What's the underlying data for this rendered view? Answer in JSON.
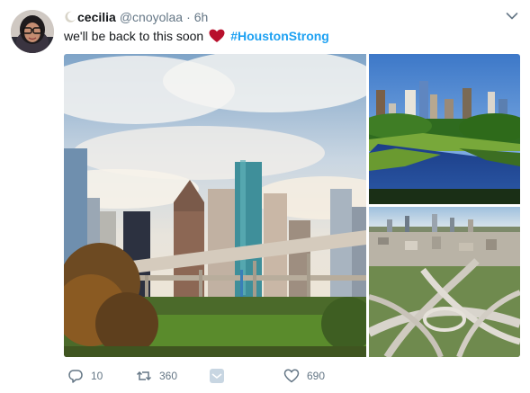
{
  "tweet": {
    "author": {
      "display_name": "cecilia",
      "handle": "@cnoyolaa",
      "separator": "·",
      "time": "6h",
      "avatar_icon": "avatar-photo",
      "name_emoji_icon": "crescent-moon-icon"
    },
    "text_before": "we'll be back to this soon",
    "emoji_icon": "red-heart-icon",
    "hashtag": "#HoustonStrong",
    "menu_icon": "chevron-down-icon",
    "media": [
      {
        "icon": "houston-skyline-photo"
      },
      {
        "icon": "houston-skyline-bayou-photo"
      },
      {
        "icon": "houston-highway-aerial-photo"
      }
    ],
    "actions": {
      "reply": {
        "icon": "reply-icon",
        "count": "10"
      },
      "retweet": {
        "icon": "retweet-icon",
        "count": "360"
      },
      "dm": {
        "icon": "direct-message-icon"
      },
      "like": {
        "icon": "heart-outline-icon",
        "count": "690"
      }
    }
  },
  "colors": {
    "accent": "#1da1f2",
    "heart": "#e0245e",
    "muted": "#657786",
    "text": "#14171a"
  }
}
